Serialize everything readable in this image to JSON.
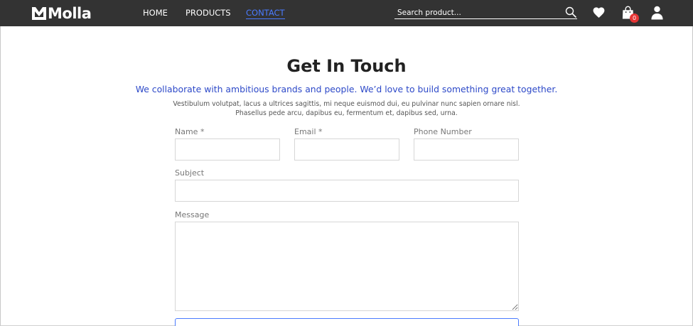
{
  "header": {
    "brand": "Molla",
    "nav": {
      "home": "HOME",
      "products": "PRODUCTS",
      "contact": "CONTACT"
    },
    "search": {
      "placeholder": "Search product..."
    },
    "cart_count": "0",
    "icons": [
      "logo-m-icon",
      "search-icon",
      "heart-icon",
      "shopping-bag-icon",
      "user-icon"
    ],
    "colors": {
      "navbar": "#333333",
      "active_link": "#4a7bff",
      "badge": "#e53535"
    }
  },
  "contact": {
    "title": "Get In Touch",
    "subtitle": "We collaborate with ambitious brands and people. We’d love to build something great together.",
    "description_line1": "Vestibulum volutpat, lacus a ultrices sagittis, mi neque euismod dui, eu pulvinar nunc sapien ornare nisl.",
    "description_line2": "Phasellus pede arcu, dapibus eu, fermentum et, dapibus sed, urna.",
    "form": {
      "name_label": "Name *",
      "email_label": "Email *",
      "phone_label": "Phone Number",
      "subject_label": "Subject",
      "message_label": "Message",
      "name_value": "",
      "email_value": "",
      "phone_value": "",
      "subject_value": "",
      "message_value": ""
    },
    "colors": {
      "subtitle": "#2d49c8"
    }
  }
}
